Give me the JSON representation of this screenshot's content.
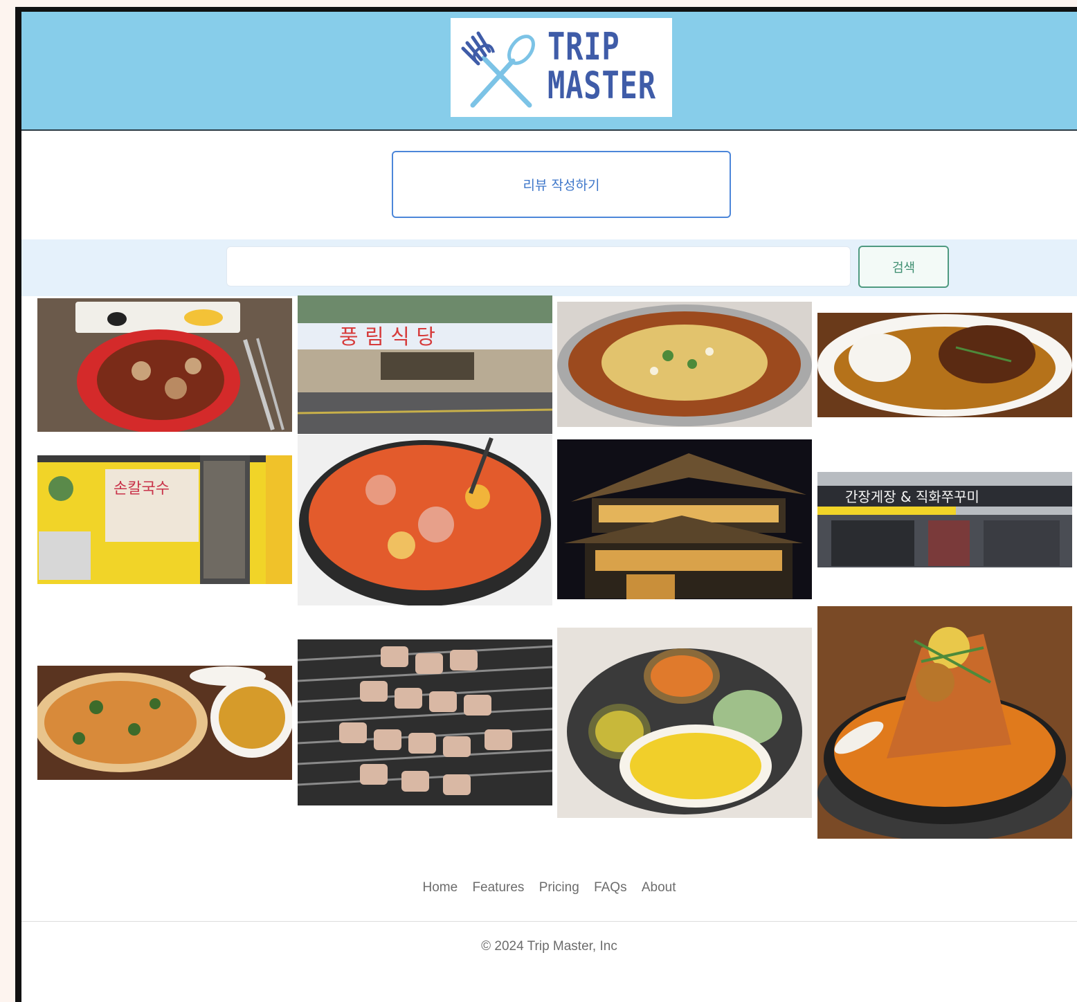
{
  "header": {
    "logo_line1": "TRIP",
    "logo_line2": "MASTER",
    "logo_color": "#3f5ca8",
    "bar_color": "#87cdea"
  },
  "review_button": {
    "label": "리뷰 작성하기"
  },
  "search": {
    "input_value": "",
    "button_label": "검색"
  },
  "gallery": [
    {
      "name": "spicy-squid-stir-fry"
    },
    {
      "name": "restaurant-storefront"
    },
    {
      "name": "ramen-pot"
    },
    {
      "name": "hamburg-steak-curry"
    },
    {
      "name": "noodle-shop-storefront"
    },
    {
      "name": "budae-jjigae-stew"
    },
    {
      "name": "hanok-building-night"
    },
    {
      "name": "crab-restaurant-building"
    },
    {
      "name": "pizza-table"
    },
    {
      "name": "grilled-pork-belly"
    },
    {
      "name": "indian-curry-platter"
    },
    {
      "name": "braised-stew-pot"
    }
  ],
  "footer": {
    "nav": [
      "Home",
      "Features",
      "Pricing",
      "FAQs",
      "About"
    ],
    "copyright": "© 2024 Trip Master, Inc"
  }
}
